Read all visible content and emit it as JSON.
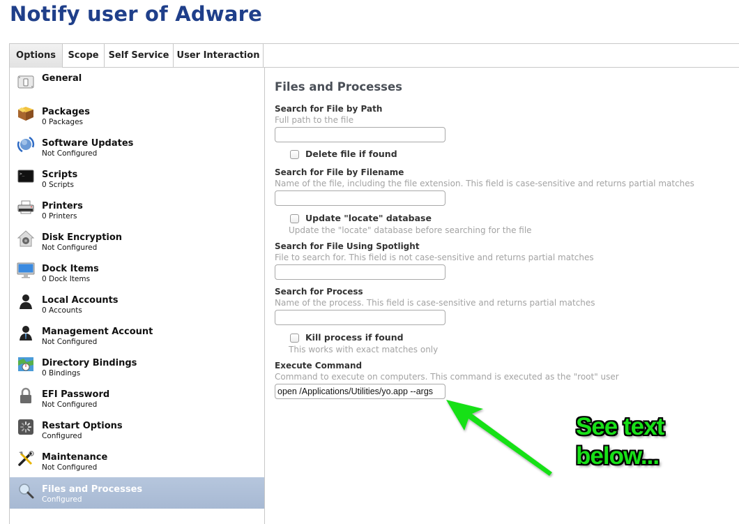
{
  "page": {
    "title": "Notify user of Adware"
  },
  "tabs": [
    {
      "label": "Options",
      "active": true
    },
    {
      "label": "Scope",
      "active": false
    },
    {
      "label": "Self Service",
      "active": false
    },
    {
      "label": "User Interaction",
      "active": false
    }
  ],
  "sidebar": {
    "items": [
      {
        "label": "General",
        "sub": "",
        "icon": "general-switch-icon"
      },
      {
        "label": "Packages",
        "sub": "0 Packages",
        "icon": "package-box-icon"
      },
      {
        "label": "Software Updates",
        "sub": "Not Configured",
        "icon": "software-update-globe-icon"
      },
      {
        "label": "Scripts",
        "sub": "0 Scripts",
        "icon": "terminal-icon"
      },
      {
        "label": "Printers",
        "sub": "0 Printers",
        "icon": "printer-icon"
      },
      {
        "label": "Disk Encryption",
        "sub": "Not Configured",
        "icon": "filevault-house-icon"
      },
      {
        "label": "Dock Items",
        "sub": "0 Dock Items",
        "icon": "monitor-icon"
      },
      {
        "label": "Local Accounts",
        "sub": "0 Accounts",
        "icon": "user-silhouette-icon"
      },
      {
        "label": "Management Account",
        "sub": "Not Configured",
        "icon": "admin-user-icon"
      },
      {
        "label": "Directory Bindings",
        "sub": "0 Bindings",
        "icon": "directory-map-icon"
      },
      {
        "label": "EFI Password",
        "sub": "Not Configured",
        "icon": "padlock-icon"
      },
      {
        "label": "Restart Options",
        "sub": "Configured",
        "icon": "restart-spinner-icon"
      },
      {
        "label": "Maintenance",
        "sub": "Not Configured",
        "icon": "tools-icon"
      },
      {
        "label": "Files and Processes",
        "sub": "Configured",
        "icon": "magnifier-icon",
        "active": true
      }
    ]
  },
  "main": {
    "section_title": "Files and Processes",
    "fields": {
      "path": {
        "label": "Search for File by Path",
        "help": "Full path to the file",
        "value": ""
      },
      "delete": {
        "label": "Delete file if found",
        "checked": false
      },
      "filename": {
        "label": "Search for File by Filename",
        "help": "Name of the file, including the file extension. This field is case-sensitive and returns partial matches",
        "value": ""
      },
      "locate": {
        "label": "Update \"locate\" database",
        "help": "Update the \"locate\" database before searching for the file",
        "checked": false
      },
      "spotlight": {
        "label": "Search for File Using Spotlight",
        "help": "File to search for. This field is not case-sensitive and returns partial matches",
        "value": ""
      },
      "process": {
        "label": "Search for Process",
        "help": "Name of the process. This field is case-sensitive and returns partial matches",
        "value": ""
      },
      "kill": {
        "label": "Kill process if found",
        "help": "This works with exact matches only",
        "checked": false
      },
      "command": {
        "label": "Execute Command",
        "help": "Command to execute on computers. This command is executed as the \"root\" user",
        "value": "open /Applications/Utilities/yo.app --args"
      }
    }
  },
  "annotation": {
    "line1": "See text",
    "line2": "below...",
    "color": "#18e018"
  }
}
